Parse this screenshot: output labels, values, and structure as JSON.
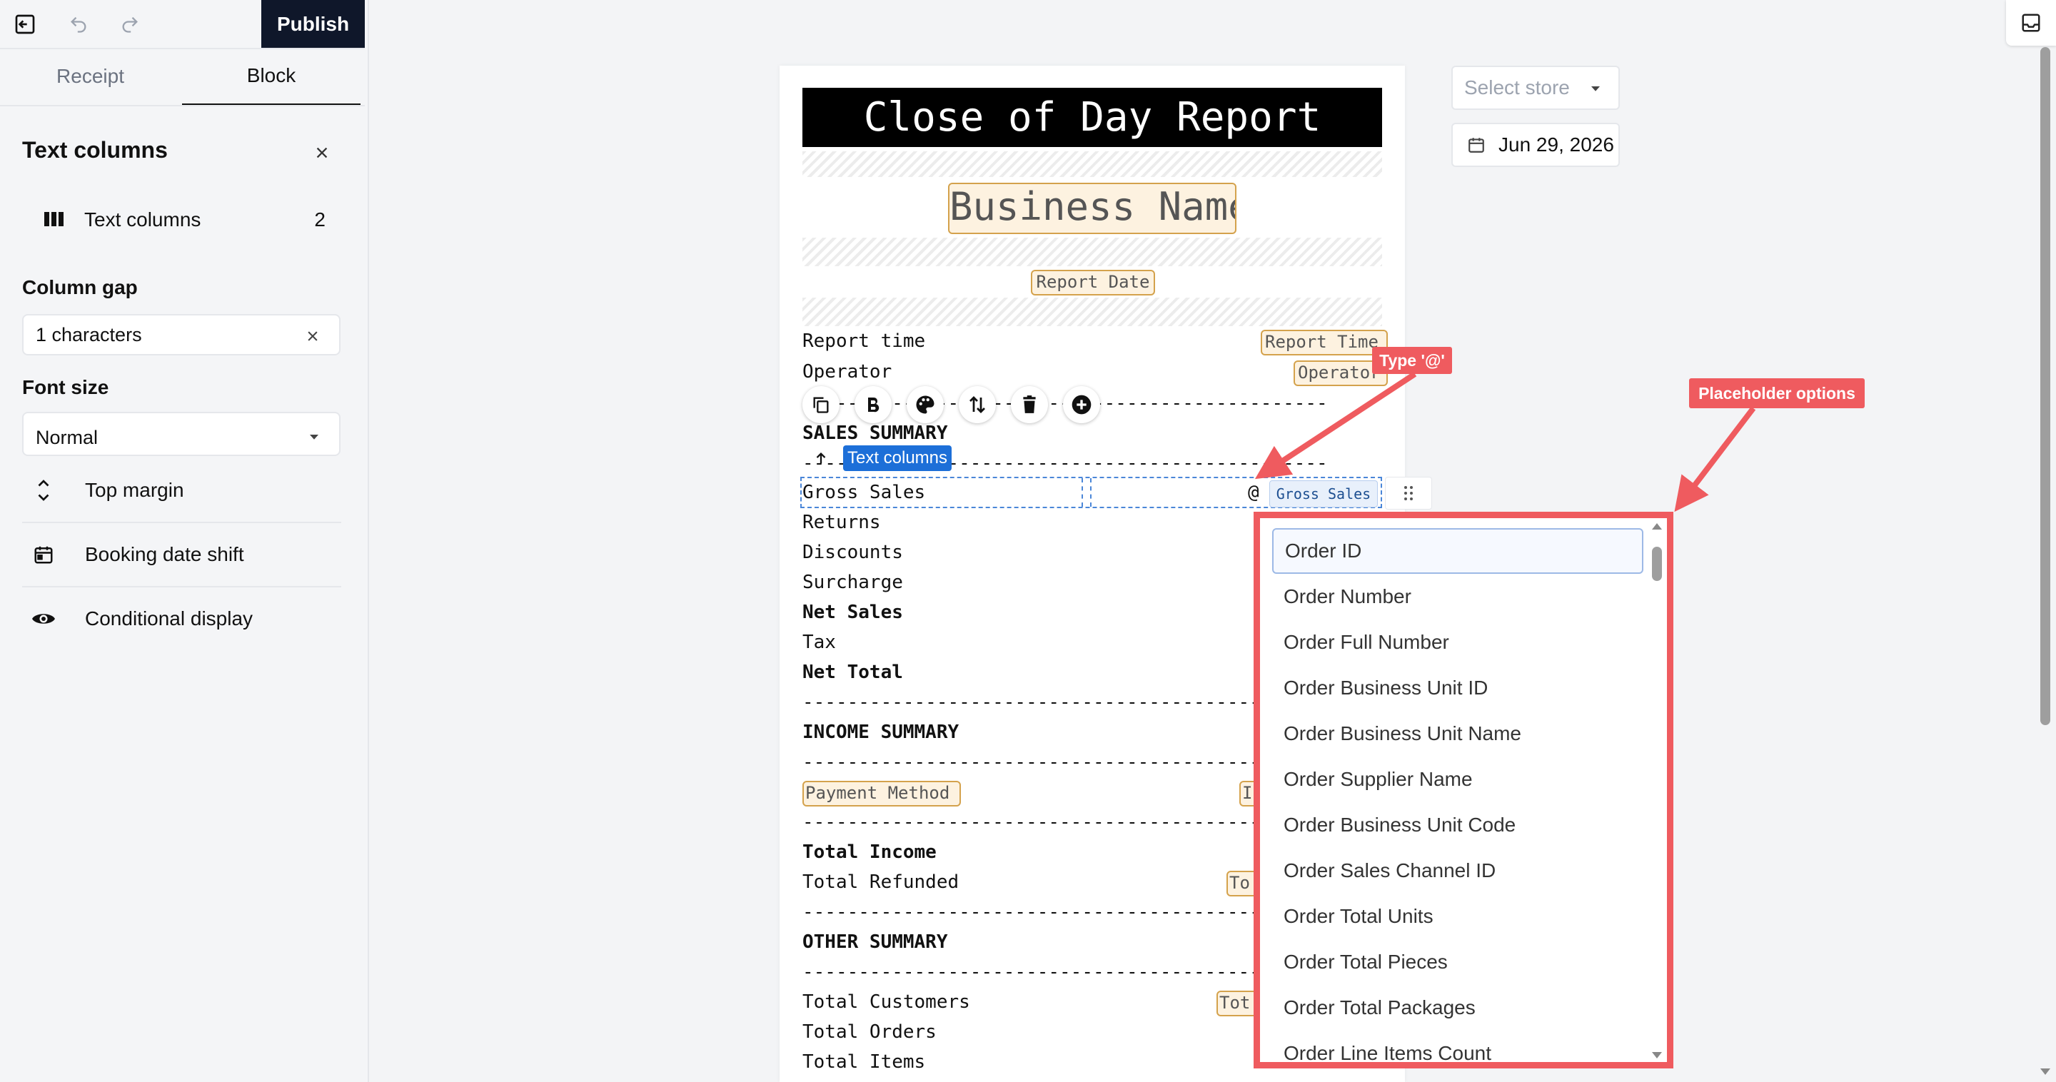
{
  "toolbar": {
    "publish_label": "Publish"
  },
  "tabs": [
    {
      "label": "Receipt"
    },
    {
      "label": "Block"
    }
  ],
  "panel": {
    "title": "Text columns",
    "columns_item": {
      "label": "Text columns",
      "value": "2"
    },
    "column_gap": {
      "label": "Column gap",
      "value": "1 characters"
    },
    "font_size": {
      "label": "Font size",
      "value": "Normal"
    },
    "items": [
      {
        "label": "Top margin"
      },
      {
        "label": "Booking date shift"
      },
      {
        "label": "Conditional display"
      }
    ]
  },
  "right_controls": {
    "store_placeholder": "Select store",
    "date": "Jun 29, 2026"
  },
  "receipt": {
    "title": "Close of Day Report",
    "business_name": "Business Name",
    "report_date": "Report Date",
    "report_time_label": "Report time",
    "report_time_ph": "Report Time",
    "operator_label": "Operator",
    "operator_ph": "Operator",
    "sales_summary": "SALES SUMMARY",
    "gross_sales": "Gross Sales",
    "at_symbol": "@",
    "gross_sales_tag": "Gross Sales",
    "rows": [
      "Returns",
      "Discounts",
      "Surcharge",
      "Net Sales",
      "Tax",
      "Net Total"
    ],
    "income_summary": "INCOME SUMMARY",
    "payment_method_ph": "Payment Method",
    "income_ph_partial": "I",
    "total_income": "Total Income",
    "total_refunded": "Total Refunded",
    "refunded_ph_partial": "To",
    "other_summary": "OTHER SUMMARY",
    "total_customers": "Total Customers",
    "customers_ph_partial": "Tot",
    "total_orders": "Total Orders",
    "total_items": "Total Items",
    "dashes": "------------------------------------------------------------"
  },
  "block_tag": "Text columns",
  "callouts": {
    "type_at": "Type '@'",
    "placeholder_options": "Placeholder options"
  },
  "placeholder_options": [
    "Order ID",
    "Order Number",
    "Order Full Number",
    "Order Business Unit ID",
    "Order Business Unit Name",
    "Order Supplier Name",
    "Order Business Unit Code",
    "Order Sales Channel ID",
    "Order Total Units",
    "Order Total Pieces",
    "Order Total Packages",
    "Order Line Items Count"
  ]
}
